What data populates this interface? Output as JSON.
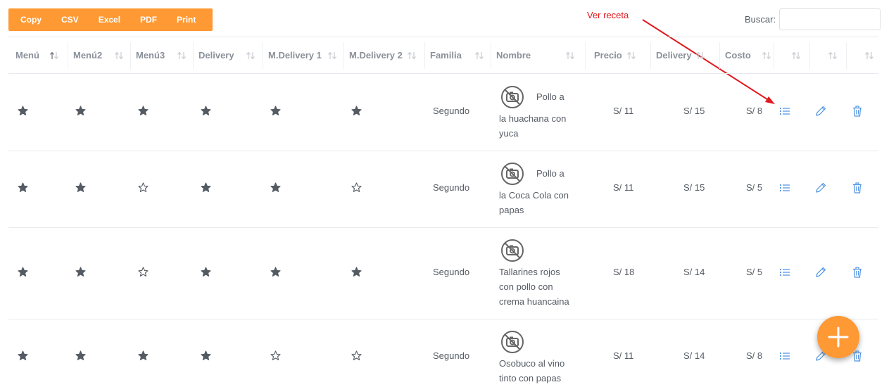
{
  "toolbar": {
    "buttons": [
      "Copy",
      "CSV",
      "Excel",
      "PDF",
      "Print"
    ]
  },
  "search": {
    "label": "Buscar:",
    "value": "",
    "placeholder": ""
  },
  "annotation": {
    "text": "Ver receta",
    "color": "#e0191e"
  },
  "columns": [
    "Menú",
    "Menú2",
    "Menú3",
    "Delivery",
    "M.Delivery 1",
    "M.Delivery 2",
    "Familia",
    "Nombre",
    "Precio",
    "Delivery",
    "Costo"
  ],
  "rows": [
    {
      "stars": [
        true,
        true,
        true,
        true,
        true,
        true
      ],
      "familia": "Segundo",
      "name_first": "Pollo a",
      "name_rest": [
        "la huachana con",
        "yuca"
      ],
      "precio": "S/ 11",
      "delivery": "S/ 15",
      "costo": "S/ 8"
    },
    {
      "stars": [
        true,
        true,
        false,
        true,
        true,
        false
      ],
      "familia": "Segundo",
      "name_first": "Pollo a",
      "name_rest": [
        "la Coca Cola con",
        "papas"
      ],
      "precio": "S/ 11",
      "delivery": "S/ 15",
      "costo": "S/ 5"
    },
    {
      "stars": [
        true,
        true,
        false,
        true,
        true,
        true
      ],
      "familia": "Segundo",
      "name_first": "",
      "name_rest": [
        "Tallarines rojos",
        "con pollo con",
        "crema huancaina"
      ],
      "precio": "S/ 18",
      "delivery": "S/ 14",
      "costo": "S/ 5"
    },
    {
      "stars": [
        true,
        true,
        true,
        true,
        false,
        false
      ],
      "familia": "Segundo",
      "name_first": "",
      "name_rest": [
        "Osobuco al vino",
        "tinto con papas"
      ],
      "precio": "S/ 11",
      "delivery": "S/ 14",
      "costo": "S/ 8"
    }
  ],
  "colors": {
    "accent": "#ff9933",
    "action_icon": "#4a90e2",
    "star": "#555b63"
  },
  "icons": {
    "sort": "sort-arrows-icon",
    "star_filled": "star-filled-icon",
    "star_empty": "star-outline-icon",
    "no_photo": "no-photo-icon",
    "view_recipe": "list-icon",
    "edit": "pencil-icon",
    "delete": "trash-icon",
    "add": "plus-icon"
  }
}
